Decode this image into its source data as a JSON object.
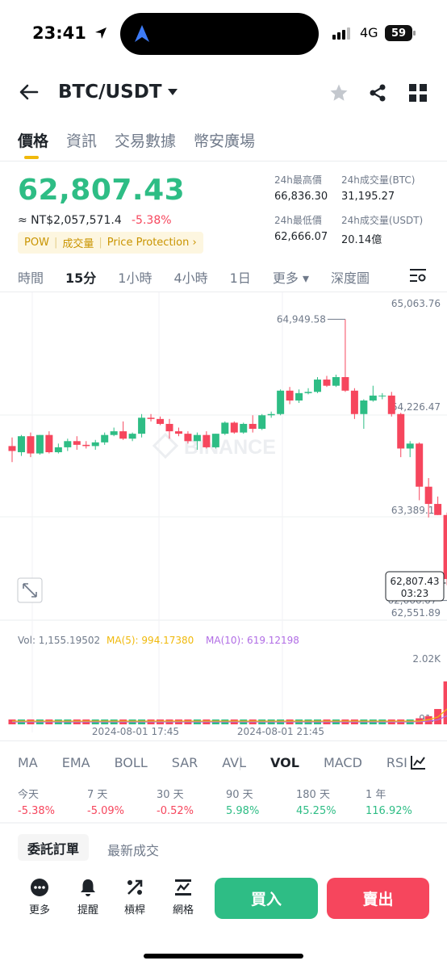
{
  "status": {
    "time": "23:41",
    "network": "4G",
    "battery": "59"
  },
  "header": {
    "pair": "BTC/USDT"
  },
  "tabs": [
    "價格",
    "資訊",
    "交易數據",
    "幣安廣場"
  ],
  "price": {
    "last": "62,807.43",
    "fiat": "≈ NT$2,057,571.4",
    "change": "-5.38%",
    "tags": [
      "POW",
      "成交量",
      "Price Protection ›"
    ]
  },
  "stats": {
    "high_label": "24h最高價",
    "high": "66,836.30",
    "low_label": "24h最低價",
    "low": "62,666.07",
    "vol_btc_label": "24h成交量(BTC)",
    "vol_btc": "31,195.27",
    "vol_usdt_label": "24h成交量(USDT)",
    "vol_usdt": "20.14億"
  },
  "intervals": [
    "時間",
    "15分",
    "1小時",
    "4小時",
    "1日",
    "更多 ▾",
    "深度圖"
  ],
  "chart_labels": {
    "price_ticks": [
      "65,063.76",
      "64,226.47",
      "63,389.18",
      "62,551.89"
    ],
    "high_marker": "64,949.58",
    "low_marker": "62,666.07",
    "last_price": "62,807.43",
    "countdown": "03:23",
    "watermark": "BINANCE",
    "vol_line": "Vol: 1,155.19502",
    "ma5": "MA(5): 994.17380",
    "ma10": "MA(10): 619.12198",
    "vol_ticks": [
      "2.02K",
      "91.8"
    ],
    "times": [
      "2024-08-01 17:45",
      "2024-08-01 21:45"
    ]
  },
  "colors": {
    "up": "#2ebd85",
    "down": "#f6465d",
    "accent": "#f0b90b",
    "ma5": "#f0b90b",
    "ma10": "#b16de5"
  },
  "chart_data": {
    "type": "candlestick",
    "interval": "15分",
    "ylim": [
      62551.89,
      65063.76
    ],
    "volume_ylim": [
      0,
      2020
    ],
    "candles": [
      {
        "o": 63920,
        "h": 63990,
        "l": 63790,
        "c": 63880
      },
      {
        "o": 63870,
        "h": 64010,
        "l": 63840,
        "c": 64000
      },
      {
        "o": 64000,
        "h": 64030,
        "l": 63830,
        "c": 63860
      },
      {
        "o": 63860,
        "h": 64010,
        "l": 63850,
        "c": 64010
      },
      {
        "o": 64010,
        "h": 64040,
        "l": 63860,
        "c": 63870
      },
      {
        "o": 63870,
        "h": 63940,
        "l": 63860,
        "c": 63910
      },
      {
        "o": 63910,
        "h": 63980,
        "l": 63880,
        "c": 63960
      },
      {
        "o": 63960,
        "h": 64000,
        "l": 63890,
        "c": 63930
      },
      {
        "o": 63930,
        "h": 63960,
        "l": 63900,
        "c": 63920
      },
      {
        "o": 63920,
        "h": 63970,
        "l": 63890,
        "c": 63950
      },
      {
        "o": 63950,
        "h": 64030,
        "l": 63930,
        "c": 64010
      },
      {
        "o": 64010,
        "h": 64070,
        "l": 64000,
        "c": 64040
      },
      {
        "o": 64040,
        "h": 64120,
        "l": 63970,
        "c": 63980
      },
      {
        "o": 63980,
        "h": 64030,
        "l": 63960,
        "c": 64020
      },
      {
        "o": 64020,
        "h": 64180,
        "l": 63990,
        "c": 64150
      },
      {
        "o": 64150,
        "h": 64180,
        "l": 64120,
        "c": 64140
      },
      {
        "o": 64140,
        "h": 64160,
        "l": 64090,
        "c": 64100
      },
      {
        "o": 64100,
        "h": 64140,
        "l": 63980,
        "c": 64040
      },
      {
        "o": 64040,
        "h": 64070,
        "l": 64000,
        "c": 64020
      },
      {
        "o": 64020,
        "h": 64040,
        "l": 63940,
        "c": 63960
      },
      {
        "o": 63960,
        "h": 64030,
        "l": 63890,
        "c": 64010
      },
      {
        "o": 64010,
        "h": 64040,
        "l": 63900,
        "c": 63910
      },
      {
        "o": 63910,
        "h": 64020,
        "l": 63900,
        "c": 64020
      },
      {
        "o": 64020,
        "h": 64120,
        "l": 64010,
        "c": 64110
      },
      {
        "o": 64110,
        "h": 64120,
        "l": 64020,
        "c": 64030
      },
      {
        "o": 64030,
        "h": 64110,
        "l": 64020,
        "c": 64100
      },
      {
        "o": 64100,
        "h": 64170,
        "l": 64030,
        "c": 64060
      },
      {
        "o": 64060,
        "h": 64180,
        "l": 64050,
        "c": 64170
      },
      {
        "o": 64170,
        "h": 64200,
        "l": 64150,
        "c": 64180
      },
      {
        "o": 64180,
        "h": 64380,
        "l": 64170,
        "c": 64370
      },
      {
        "o": 64370,
        "h": 64400,
        "l": 64260,
        "c": 64290
      },
      {
        "o": 64290,
        "h": 64380,
        "l": 64270,
        "c": 64350
      },
      {
        "o": 64350,
        "h": 64390,
        "l": 64340,
        "c": 64360
      },
      {
        "o": 64360,
        "h": 64480,
        "l": 64350,
        "c": 64460
      },
      {
        "o": 64460,
        "h": 64490,
        "l": 64400,
        "c": 64410
      },
      {
        "o": 64410,
        "h": 64500,
        "l": 64400,
        "c": 64480
      },
      {
        "o": 64480,
        "h": 64949.58,
        "l": 64360,
        "c": 64370
      },
      {
        "o": 64370,
        "h": 64390,
        "l": 64140,
        "c": 64180
      },
      {
        "o": 64180,
        "h": 64300,
        "l": 64060,
        "c": 64290
      },
      {
        "o": 64290,
        "h": 64410,
        "l": 64280,
        "c": 64330
      },
      {
        "o": 64330,
        "h": 64350,
        "l": 64300,
        "c": 64330
      },
      {
        "o": 64330,
        "h": 64360,
        "l": 64160,
        "c": 64180
      },
      {
        "o": 64180,
        "h": 64190,
        "l": 63830,
        "c": 63900
      },
      {
        "o": 63900,
        "h": 63960,
        "l": 63830,
        "c": 63940
      },
      {
        "o": 63940,
        "h": 63950,
        "l": 63480,
        "c": 63590
      },
      {
        "o": 63590,
        "h": 63660,
        "l": 63340,
        "c": 63450
      },
      {
        "o": 63450,
        "h": 63510,
        "l": 63360,
        "c": 63360
      },
      {
        "o": 63360,
        "h": 63380,
        "l": 62790,
        "c": 62840
      },
      {
        "o": 62840,
        "h": 62880,
        "l": 62666.07,
        "c": 62807.43
      }
    ],
    "volumes": [
      62,
      40,
      70,
      58,
      64,
      42,
      37,
      39,
      31,
      48,
      55,
      62,
      47,
      37,
      88,
      43,
      35,
      71,
      38,
      40,
      59,
      26,
      49,
      55,
      34,
      26,
      28,
      38,
      36,
      82,
      34,
      31,
      29,
      38,
      47,
      46,
      78,
      53,
      42,
      37,
      33,
      51,
      74,
      115,
      163,
      220,
      412,
      1155.19502,
      880
    ],
    "ma5_last": 994.1738,
    "ma10_last": 619.12198
  },
  "indicators": [
    "MA",
    "EMA",
    "BOLL",
    "SAR",
    "AVL",
    "VOL",
    "MACD",
    "RSI"
  ],
  "performance": [
    {
      "label": "今天",
      "value": "-5.38%"
    },
    {
      "label": "7 天",
      "value": "-5.09%"
    },
    {
      "label": "30 天",
      "value": "-0.52%"
    },
    {
      "label": "90 天",
      "value": "5.98%"
    },
    {
      "label": "180 天",
      "value": "45.25%"
    },
    {
      "label": "1 年",
      "value": "116.92%"
    }
  ],
  "order_tabs": [
    "委託訂單",
    "最新成交"
  ],
  "tools": [
    "更多",
    "提醒",
    "槓桿",
    "網格"
  ],
  "actions": {
    "buy": "買入",
    "sell": "賣出"
  }
}
